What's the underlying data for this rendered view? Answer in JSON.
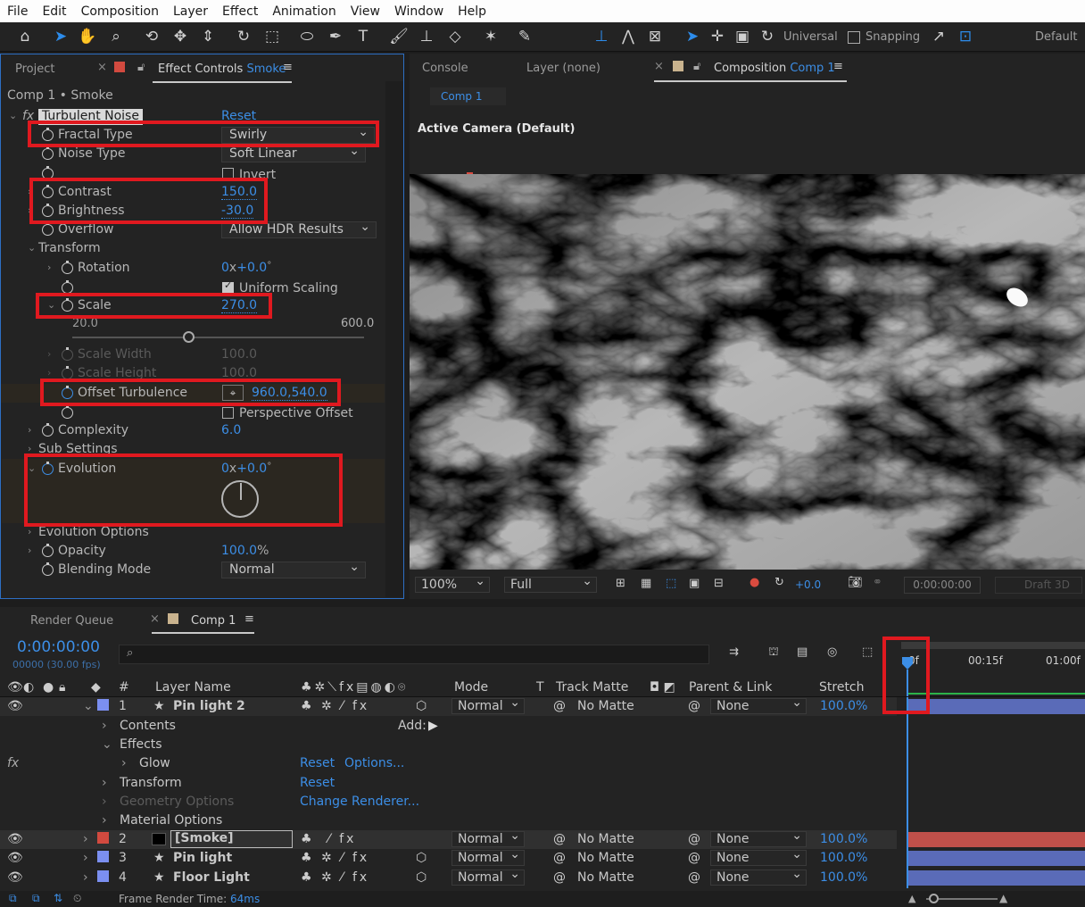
{
  "menu": [
    "File",
    "Edit",
    "Composition",
    "Layer",
    "Effect",
    "Animation",
    "View",
    "Window",
    "Help"
  ],
  "toolbar": {
    "universal_label": "Universal",
    "snapping_label": "Snapping",
    "workspace_label": "Default"
  },
  "left_panel": {
    "tab_project": "Project",
    "tab_effect_controls_prefix": "Effect Controls",
    "tab_effect_controls_layer": "Smoke",
    "breadcrumb": "Comp 1 • Smoke",
    "effect_name": "Turbulent Noise",
    "reset": "Reset",
    "fractal_type": {
      "label": "Fractal Type",
      "value": "Swirly"
    },
    "noise_type": {
      "label": "Noise Type",
      "value": "Soft Linear"
    },
    "invert": {
      "label": "Invert"
    },
    "contrast": {
      "label": "Contrast",
      "value": "150.0"
    },
    "brightness": {
      "label": "Brightness",
      "value": "-30.0"
    },
    "overflow": {
      "label": "Overflow",
      "value": "Allow HDR Results"
    },
    "transform": {
      "label": "Transform"
    },
    "rotation": {
      "label": "Rotation",
      "value_rev": "0",
      "value_x": "x",
      "value_deg": "+0.0",
      "value_unit": "°"
    },
    "uniform_scaling": {
      "label": "Uniform Scaling"
    },
    "scale": {
      "label": "Scale",
      "value": "270.0",
      "min": "20.0",
      "max": "600.0",
      "slider_pos": 0.4
    },
    "scale_width": {
      "label": "Scale Width",
      "value": "100.0"
    },
    "scale_height": {
      "label": "Scale Height",
      "value": "100.0"
    },
    "offset_turbulence": {
      "label": "Offset Turbulence",
      "value": "960.0,540.0"
    },
    "perspective_offset": {
      "label": "Perspective Offset"
    },
    "complexity": {
      "label": "Complexity",
      "value": "6.0"
    },
    "sub_settings": {
      "label": "Sub Settings"
    },
    "evolution": {
      "label": "Evolution",
      "value_rev": "0",
      "value_x": "x",
      "value_deg": "+0.0",
      "value_unit": "°"
    },
    "evolution_options": {
      "label": "Evolution Options"
    },
    "opacity": {
      "label": "Opacity",
      "value": "100.0",
      "unit": "%"
    },
    "blending_mode": {
      "label": "Blending Mode",
      "value": "Normal"
    }
  },
  "right_panel": {
    "tab_console": "Console",
    "tab_layer": "Layer (none)",
    "tab_composition_prefix": "Composition",
    "tab_composition_name": "Comp 1",
    "subtab": "Comp 1",
    "camera_label": "Active Camera (Default)",
    "zoom": "100%",
    "resolution": "Full",
    "exposure": "+0.0",
    "timecode": "0:00:00:00",
    "draft3d": "Draft 3D"
  },
  "timeline": {
    "tab_render_queue": "Render Queue",
    "tab_comp": "Comp 1",
    "current_time": "0:00:00:00",
    "frame_info": "00000 (30.00 fps)",
    "search_placeholder": "",
    "ruler": [
      "0f",
      "00:15f",
      "01:00f"
    ],
    "headers": {
      "hash": "#",
      "layer_name": "Layer Name",
      "mode": "Mode",
      "t": "T",
      "track_matte": "Track Matte",
      "parent_link": "Parent & Link",
      "stretch": "Stretch"
    },
    "layers": [
      {
        "num": "1",
        "name": "Pin light 2",
        "mode": "Normal",
        "matte": "No Matte",
        "parent": "None",
        "stretch": "100.0%",
        "color": "#7b8ff0"
      },
      {
        "num": "2",
        "name": "[Smoke]",
        "mode": "Normal",
        "matte": "No Matte",
        "parent": "None",
        "stretch": "100.0%",
        "color": "#d24a3f"
      },
      {
        "num": "3",
        "name": "Pin light",
        "mode": "Normal",
        "matte": "No Matte",
        "parent": "None",
        "stretch": "100.0%",
        "color": "#7b8ff0"
      },
      {
        "num": "4",
        "name": "Floor Light",
        "mode": "Normal",
        "matte": "No Matte",
        "parent": "None",
        "stretch": "100.0%",
        "color": "#7b8ff0"
      }
    ],
    "sub_rows": {
      "contents": "Contents",
      "add": "Add:",
      "effects": "Effects",
      "glow": "Glow",
      "glow_reset": "Reset",
      "glow_options": "Options...",
      "transform": "Transform",
      "transform_reset": "Reset",
      "geometry": "Geometry Options",
      "geometry_action": "Change Renderer...",
      "material": "Material Options"
    },
    "footer_prefix": "Frame Render Time:",
    "footer_value": "64ms"
  },
  "colors": {
    "accent": "#2d8ceb",
    "highlight": "#e0191f",
    "smoke_track": "#c0504a",
    "light_track": "#5a6bb8"
  }
}
